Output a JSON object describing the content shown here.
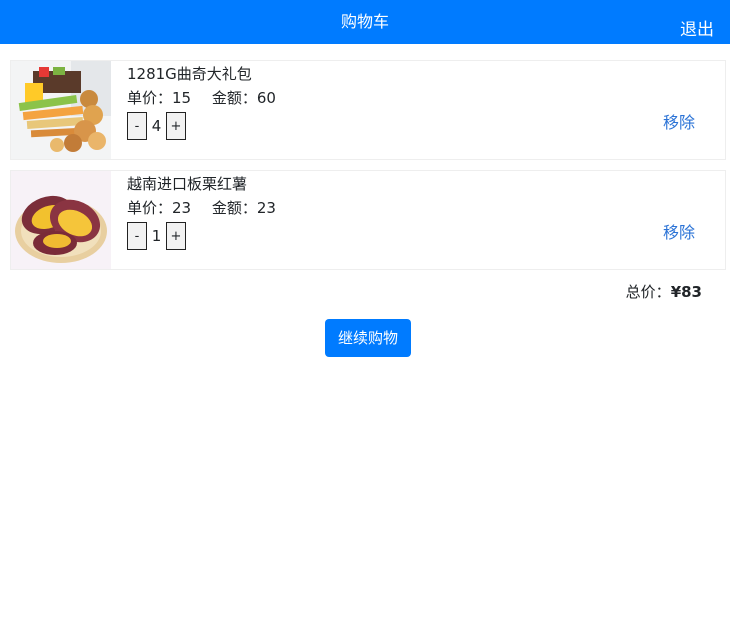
{
  "header": {
    "title": "购物车",
    "logout_label": "退出"
  },
  "cart": {
    "items": [
      {
        "name": "1281G曲奇大礼包",
        "unit_price_label": "单价：15",
        "amount_label": "金额：60",
        "quantity": "4",
        "minus": "-",
        "plus": "+",
        "remove_label": "移除",
        "image": "cookie-gift-box"
      },
      {
        "name": "越南进口板栗红薯",
        "unit_price_label": "单价：23",
        "amount_label": "金额：23",
        "quantity": "1",
        "minus": "-",
        "plus": "+",
        "remove_label": "移除",
        "image": "roasted-sweet-potato"
      }
    ],
    "total_label": "总价：",
    "total_value": "¥83"
  },
  "actions": {
    "continue_label": "继续购物"
  },
  "colors": {
    "accent": "#007bff",
    "link": "#2b73d6"
  }
}
